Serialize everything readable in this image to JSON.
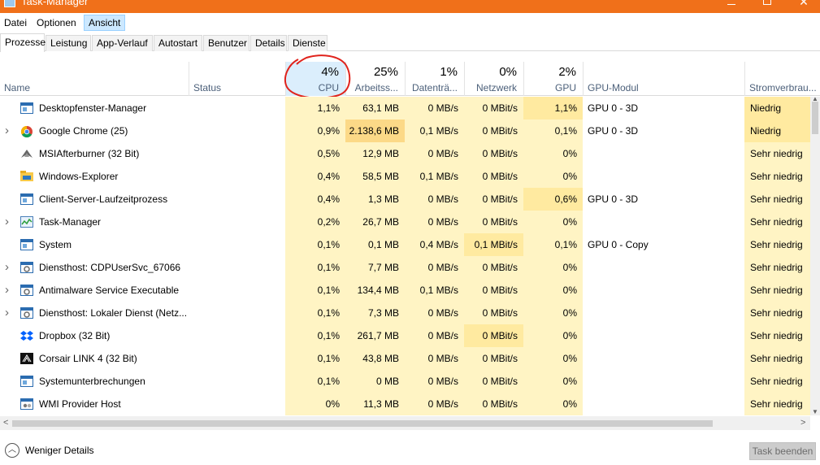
{
  "window": {
    "title": "Task-Manager"
  },
  "menu": [
    "Datei",
    "Optionen",
    "Ansicht"
  ],
  "tabs": [
    "Prozesse",
    "Leistung",
    "App-Verlauf",
    "Autostart",
    "Benutzer",
    "Details",
    "Dienste"
  ],
  "columns": {
    "name": "Name",
    "status": "Status",
    "cpu": {
      "pct": "4%",
      "label": "CPU"
    },
    "memory": {
      "pct": "25%",
      "label": "Arbeitss..."
    },
    "disk": {
      "pct": "1%",
      "label": "Datenträ..."
    },
    "network": {
      "pct": "0%",
      "label": "Netzwerk"
    },
    "gpu": {
      "pct": "2%",
      "label": "GPU"
    },
    "gpu_engine": "GPU-Modul",
    "power": "Stromverbrau..."
  },
  "processes": [
    {
      "name": "Desktopfenster-Manager",
      "icon": "window-app-icon",
      "expand": false,
      "cpu": "1,1%",
      "mem": "63,1 MB",
      "disk": "0 MB/s",
      "net": "0 MBit/s",
      "gpu": "1,1%",
      "gpu_engine": "GPU 0 - 3D",
      "power": "Niedrig",
      "heat": [
        "h1",
        "h1",
        "h1",
        "h1",
        "h2",
        "",
        "h2"
      ]
    },
    {
      "name": "Google Chrome (25)",
      "icon": "chrome-icon",
      "expand": true,
      "cpu": "0,9%",
      "mem": "2.138,6 MB",
      "disk": "0,1 MB/s",
      "net": "0 MBit/s",
      "gpu": "0,1%",
      "gpu_engine": "GPU 0 - 3D",
      "power": "Niedrig",
      "heat": [
        "h1",
        "h3",
        "h1",
        "h1",
        "h1",
        "",
        "h2"
      ]
    },
    {
      "name": "MSIAfterburner (32 Bit)",
      "icon": "afterburner-icon",
      "expand": false,
      "cpu": "0,5%",
      "mem": "12,9 MB",
      "disk": "0 MB/s",
      "net": "0 MBit/s",
      "gpu": "0%",
      "gpu_engine": "",
      "power": "Sehr niedrig",
      "heat": [
        "h1",
        "h1",
        "h1",
        "h1",
        "h1",
        "",
        "h1"
      ]
    },
    {
      "name": "Windows-Explorer",
      "icon": "folder-icon",
      "expand": false,
      "cpu": "0,4%",
      "mem": "58,5 MB",
      "disk": "0,1 MB/s",
      "net": "0 MBit/s",
      "gpu": "0%",
      "gpu_engine": "",
      "power": "Sehr niedrig",
      "heat": [
        "h1",
        "h1",
        "h1",
        "h1",
        "h1",
        "",
        "h1"
      ]
    },
    {
      "name": "Client-Server-Laufzeitprozess",
      "icon": "window-app-icon",
      "expand": false,
      "cpu": "0,4%",
      "mem": "1,3 MB",
      "disk": "0 MB/s",
      "net": "0 MBit/s",
      "gpu": "0,6%",
      "gpu_engine": "GPU 0 - 3D",
      "power": "Sehr niedrig",
      "heat": [
        "h1",
        "h1",
        "h1",
        "h1",
        "h2",
        "",
        "h1"
      ]
    },
    {
      "name": "Task-Manager",
      "icon": "task-manager-icon",
      "expand": true,
      "cpu": "0,2%",
      "mem": "26,7 MB",
      "disk": "0 MB/s",
      "net": "0 MBit/s",
      "gpu": "0%",
      "gpu_engine": "",
      "power": "Sehr niedrig",
      "heat": [
        "h1",
        "h1",
        "h1",
        "h1",
        "h1",
        "",
        "h1"
      ]
    },
    {
      "name": "System",
      "icon": "window-app-icon",
      "expand": false,
      "cpu": "0,1%",
      "mem": "0,1 MB",
      "disk": "0,4 MB/s",
      "net": "0,1 MBit/s",
      "gpu": "0,1%",
      "gpu_engine": "GPU 0 - Copy",
      "power": "Sehr niedrig",
      "heat": [
        "h1",
        "h1",
        "h1",
        "h2",
        "h1",
        "",
        "h1"
      ]
    },
    {
      "name": "Diensthost: CDPUserSvc_67066",
      "icon": "service-icon",
      "expand": true,
      "cpu": "0,1%",
      "mem": "7,7 MB",
      "disk": "0 MB/s",
      "net": "0 MBit/s",
      "gpu": "0%",
      "gpu_engine": "",
      "power": "Sehr niedrig",
      "heat": [
        "h1",
        "h1",
        "h1",
        "h1",
        "h1",
        "",
        "h1"
      ]
    },
    {
      "name": "Antimalware Service Executable",
      "icon": "service-icon",
      "expand": true,
      "cpu": "0,1%",
      "mem": "134,4 MB",
      "disk": "0,1 MB/s",
      "net": "0 MBit/s",
      "gpu": "0%",
      "gpu_engine": "",
      "power": "Sehr niedrig",
      "heat": [
        "h1",
        "h1",
        "h1",
        "h1",
        "h1",
        "",
        "h1"
      ]
    },
    {
      "name": "Diensthost: Lokaler Dienst (Netz...",
      "icon": "service-icon",
      "expand": true,
      "cpu": "0,1%",
      "mem": "7,3 MB",
      "disk": "0 MB/s",
      "net": "0 MBit/s",
      "gpu": "0%",
      "gpu_engine": "",
      "power": "Sehr niedrig",
      "heat": [
        "h1",
        "h1",
        "h1",
        "h1",
        "h1",
        "",
        "h1"
      ]
    },
    {
      "name": "Dropbox (32 Bit)",
      "icon": "dropbox-icon",
      "expand": false,
      "cpu": "0,1%",
      "mem": "261,7 MB",
      "disk": "0 MB/s",
      "net": "0 MBit/s",
      "gpu": "0%",
      "gpu_engine": "",
      "power": "Sehr niedrig",
      "heat": [
        "h1",
        "h1",
        "h1",
        "h2",
        "h1",
        "",
        "h1"
      ]
    },
    {
      "name": "Corsair LINK 4 (32 Bit)",
      "icon": "corsair-icon",
      "expand": false,
      "cpu": "0,1%",
      "mem": "43,8 MB",
      "disk": "0 MB/s",
      "net": "0 MBit/s",
      "gpu": "0%",
      "gpu_engine": "",
      "power": "Sehr niedrig",
      "heat": [
        "h1",
        "h1",
        "h1",
        "h1",
        "h1",
        "",
        "h1"
      ]
    },
    {
      "name": "Systemunterbrechungen",
      "icon": "window-app-icon",
      "expand": false,
      "cpu": "0,1%",
      "mem": "0 MB",
      "disk": "0 MB/s",
      "net": "0 MBit/s",
      "gpu": "0%",
      "gpu_engine": "",
      "power": "Sehr niedrig",
      "heat": [
        "h1",
        "h1",
        "h1",
        "h1",
        "h1",
        "",
        "h1"
      ]
    },
    {
      "name": "WMI Provider Host",
      "icon": "wmi-icon",
      "expand": false,
      "cpu": "0%",
      "mem": "11,3 MB",
      "disk": "0 MB/s",
      "net": "0 MBit/s",
      "gpu": "0%",
      "gpu_engine": "",
      "power": "Sehr niedrig",
      "heat": [
        "h1",
        "h1",
        "h1",
        "h1",
        "h1",
        "",
        "h1"
      ]
    }
  ],
  "footer": {
    "less_details": "Weniger Details",
    "end_task": "Task beenden"
  },
  "annotation": {
    "color": "#e0231c",
    "target": "CPU column header"
  }
}
